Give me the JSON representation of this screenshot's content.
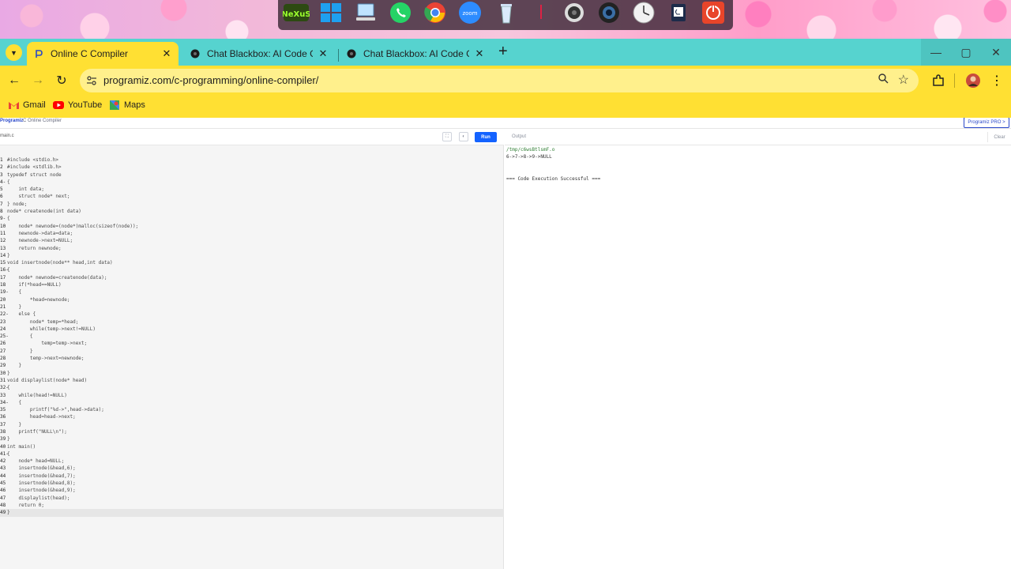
{
  "dock": {
    "icons": [
      "nexus-icon",
      "windows-icon",
      "this-pc-icon",
      "whatsapp-icon",
      "chrome-icon",
      "zoom-icon",
      "recycle-bin-icon",
      "webcam-icon",
      "camera-icon",
      "clock-icon",
      "clipboard-icon",
      "power-icon"
    ],
    "nexus_label": "NeXuS",
    "zoom_label": "zoom"
  },
  "browser": {
    "tabs": [
      {
        "title": "Online C Compiler",
        "active": true
      },
      {
        "title": "Chat Blackbox: AI Code Generat",
        "active": false
      },
      {
        "title": "Chat Blackbox: AI Code Generat",
        "active": false
      }
    ],
    "url": "programiz.com/c-programming/online-compiler/",
    "bookmarks": [
      {
        "label": "Gmail"
      },
      {
        "label": "YouTube"
      },
      {
        "label": "Maps"
      }
    ],
    "accent": "#ffe033",
    "tabstrip_color": "#56d3cf"
  },
  "page": {
    "brand": "Programiz",
    "breadcrumb": "C Online Compiler",
    "pro_button": "Programiz PRO >",
    "file_name": "main.c",
    "run_label": "Run",
    "output_title": "Output",
    "clear_label": "Clear",
    "code_lines": [
      {
        "g": "1",
        "t": "#include <stdio.h>"
      },
      {
        "g": "2",
        "t": "#include <stdlib.h>"
      },
      {
        "g": "3",
        "t": "typedef struct node"
      },
      {
        "g": "4-",
        "t": "{"
      },
      {
        "g": "5",
        "t": "    int data;"
      },
      {
        "g": "6",
        "t": "    struct node* next;"
      },
      {
        "g": "7",
        "t": "} node;"
      },
      {
        "g": "8",
        "t": "node* createnode(int data)"
      },
      {
        "g": "9-",
        "t": "{"
      },
      {
        "g": "10",
        "t": "    node* newnode=(node*)malloc(sizeof(node));"
      },
      {
        "g": "11",
        "t": "    newnode->data=data;"
      },
      {
        "g": "12",
        "t": "    newnode->next=NULL;"
      },
      {
        "g": "13",
        "t": "    return newnode;"
      },
      {
        "g": "14",
        "t": "}"
      },
      {
        "g": "15",
        "t": "void insertnode(node** head,int data)"
      },
      {
        "g": "16-",
        "t": "{"
      },
      {
        "g": "17",
        "t": "    node* newnode=createnode(data);"
      },
      {
        "g": "18",
        "t": "    if(*head==NULL)"
      },
      {
        "g": "19-",
        "t": "    {"
      },
      {
        "g": "20",
        "t": "        *head=newnode;"
      },
      {
        "g": "21",
        "t": "    }"
      },
      {
        "g": "22-",
        "t": "    else {"
      },
      {
        "g": "23",
        "t": "        node* temp=*head;"
      },
      {
        "g": "24",
        "t": "        while(temp->next!=NULL)"
      },
      {
        "g": "25-",
        "t": "        {"
      },
      {
        "g": "26",
        "t": "            temp=temp->next;"
      },
      {
        "g": "27",
        "t": "        }"
      },
      {
        "g": "28",
        "t": "        temp->next=newnode;"
      },
      {
        "g": "29",
        "t": "    }"
      },
      {
        "g": "30",
        "t": "}"
      },
      {
        "g": "31",
        "t": "void displaylist(node* head)"
      },
      {
        "g": "32-",
        "t": "{"
      },
      {
        "g": "33",
        "t": "    while(head!=NULL)"
      },
      {
        "g": "34-",
        "t": "    {"
      },
      {
        "g": "35",
        "t": "        printf(\"%d->\",head->data);"
      },
      {
        "g": "36",
        "t": "        head=head->next;"
      },
      {
        "g": "37",
        "t": "    }"
      },
      {
        "g": "38",
        "t": "    printf(\"NULL\\n\");"
      },
      {
        "g": "39",
        "t": "}"
      },
      {
        "g": "40",
        "t": "int main()"
      },
      {
        "g": "41-",
        "t": "{"
      },
      {
        "g": "42",
        "t": "    node* head=NULL;"
      },
      {
        "g": "43",
        "t": "    insertnode(&head,6);"
      },
      {
        "g": "44",
        "t": "    insertnode(&head,7);"
      },
      {
        "g": "45",
        "t": "    insertnode(&head,8);"
      },
      {
        "g": "46",
        "t": "    insertnode(&head,9);"
      },
      {
        "g": "47",
        "t": "    displaylist(head);"
      },
      {
        "g": "48",
        "t": "    return 0;"
      },
      {
        "g": "49",
        "t": "}"
      }
    ],
    "current_line": 48,
    "output_lines": [
      "/tmp/c6wsBtlsmF.o",
      "6->7->8->9->NULL",
      "",
      "",
      "=== Code Execution Successful ==="
    ]
  }
}
